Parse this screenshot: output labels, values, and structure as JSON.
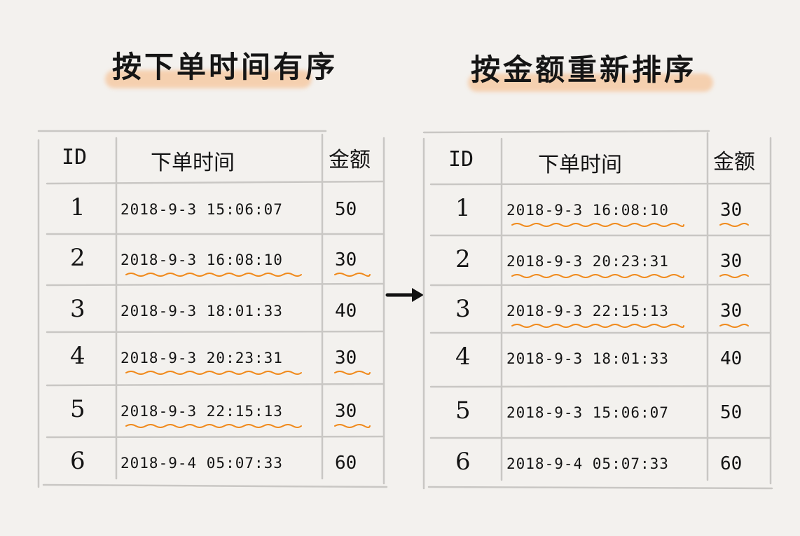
{
  "colors": {
    "background": "#f3f1ee",
    "highlight": "#f6c59b",
    "underline": "#f08a1c",
    "grid": "#c9c7c4",
    "ink": "#141414"
  },
  "left_table": {
    "title": "按下单时间有序",
    "headers": {
      "id": "ID",
      "time": "下单时间",
      "amount": "金额"
    },
    "rows": [
      {
        "id": "1",
        "time": "2018-9-3 15:06:07",
        "amount": "50",
        "underlined": false
      },
      {
        "id": "2",
        "time": "2018-9-3 16:08:10",
        "amount": "30",
        "underlined": true
      },
      {
        "id": "3",
        "time": "2018-9-3 18:01:33",
        "amount": "40",
        "underlined": false
      },
      {
        "id": "4",
        "time": "2018-9-3 20:23:31",
        "amount": "30",
        "underlined": true
      },
      {
        "id": "5",
        "time": "2018-9-3 22:15:13",
        "amount": "30",
        "underlined": true
      },
      {
        "id": "6",
        "time": "2018-9-4 05:07:33",
        "amount": "60",
        "underlined": false
      }
    ]
  },
  "right_table": {
    "title": "按金额重新排序",
    "headers": {
      "id": "ID",
      "time": "下单时间",
      "amount": "金额"
    },
    "rows": [
      {
        "id": "1",
        "time": "2018-9-3 16:08:10",
        "amount": "30",
        "underlined": true
      },
      {
        "id": "2",
        "time": "2018-9-3 20:23:31",
        "amount": "30",
        "underlined": true
      },
      {
        "id": "3",
        "time": "2018-9-3 22:15:13",
        "amount": "30",
        "underlined": true
      },
      {
        "id": "4",
        "time": "2018-9-3 18:01:33",
        "amount": "40",
        "underlined": false
      },
      {
        "id": "5",
        "time": "2018-9-3 15:06:07",
        "amount": "50",
        "underlined": false
      },
      {
        "id": "6",
        "time": "2018-9-4 05:07:33",
        "amount": "60",
        "underlined": false
      }
    ]
  },
  "arrow_icon": "right-arrow-icon"
}
